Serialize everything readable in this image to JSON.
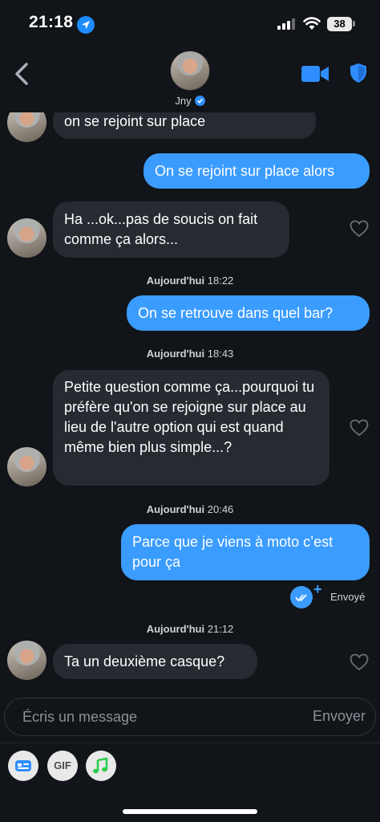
{
  "status_bar": {
    "time": "21:18",
    "battery": "38"
  },
  "header": {
    "contact_name": "Jny"
  },
  "messages": [
    {
      "dir": "in",
      "text": "on se rejoint sur place"
    },
    {
      "dir": "out",
      "text": "On se rejoint sur place alors"
    },
    {
      "dir": "in",
      "text": "Ha ...ok...pas de soucis on fait comme ça alors..."
    },
    {
      "dir": "ts",
      "day": "Aujourd'hui",
      "time": "18:22"
    },
    {
      "dir": "out",
      "text": "On se retrouve dans quel bar?"
    },
    {
      "dir": "ts",
      "day": "Aujourd'hui",
      "time": "18:43"
    },
    {
      "dir": "in",
      "text": "Petite question comme ça...pourquoi tu préfère qu'on se rejoigne sur place au lieu de l'autre option qui est quand même bien plus simple...?"
    },
    {
      "dir": "ts",
      "day": "Aujourd'hui",
      "time": "20:46"
    },
    {
      "dir": "out",
      "text": "Parce que je viens à moto c’est pour ça"
    },
    {
      "dir": "ts",
      "day": "Aujourd'hui",
      "time": "21:12"
    },
    {
      "dir": "in",
      "text": "Ta un deuxième casque?"
    }
  ],
  "delivery_status": "Envoyé",
  "composer": {
    "placeholder": "Écris un message",
    "send_label": "Envoyer"
  },
  "toolbar": {
    "gif_label": "GIF"
  },
  "colors": {
    "accent": "#3b9cff",
    "background": "#111418",
    "incoming_bubble": "#262a31"
  },
  "icons": [
    "back-arrow-icon",
    "video-call-icon",
    "shield-icon",
    "heart-icon",
    "sticker-icon",
    "music-icon",
    "verified-badge-icon"
  ]
}
